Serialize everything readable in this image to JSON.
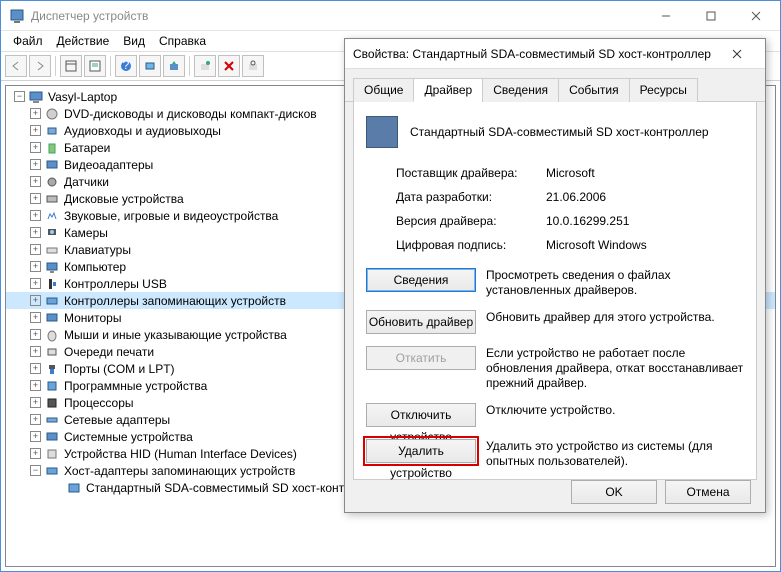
{
  "window": {
    "title": "Диспетчер устройств"
  },
  "menu": {
    "file": "Файл",
    "action": "Действие",
    "view": "Вид",
    "help": "Справка"
  },
  "tree": {
    "root": "Vasyl-Laptop",
    "items": [
      "DVD-дисководы и дисководы компакт-дисков",
      "Аудиовходы и аудиовыходы",
      "Батареи",
      "Видеоадаптеры",
      "Датчики",
      "Дисковые устройства",
      "Звуковые, игровые и видеоустройства",
      "Камеры",
      "Клавиатуры",
      "Компьютер",
      "Контроллеры USB",
      "Контроллеры запоминающих устройств",
      "Мониторы",
      "Мыши и иные указывающие устройства",
      "Очереди печати",
      "Порты (COM и LPT)",
      "Программные устройства",
      "Процессоры",
      "Сетевые адаптеры",
      "Системные устройства",
      "Устройства HID (Human Interface Devices)",
      "Хост-адаптеры запоминающих устройств"
    ],
    "child": "Стандартный SDA-совместимый SD хост-контроллер"
  },
  "dialog": {
    "title": "Свойства: Стандартный SDA-совместимый SD хост-контроллер",
    "tabs": {
      "general": "Общие",
      "driver": "Драйвер",
      "details": "Сведения",
      "events": "События",
      "resources": "Ресурсы"
    },
    "device_name": "Стандартный SDA-совместимый SD хост-контроллер",
    "labels": {
      "vendor": "Поставщик драйвера:",
      "date": "Дата разработки:",
      "version": "Версия драйвера:",
      "sig": "Цифровая подпись:"
    },
    "values": {
      "vendor": "Microsoft",
      "date": "21.06.2006",
      "version": "10.0.16299.251",
      "sig": "Microsoft Windows"
    },
    "buttons": {
      "details": "Сведения",
      "details_desc": "Просмотреть сведения о файлах установленных драйверов.",
      "update": "Обновить драйвер",
      "update_desc": "Обновить драйвер для этого устройства.",
      "rollback": "Откатить",
      "rollback_desc": "Если устройство не работает после обновления драйвера, откат восстанавливает прежний драйвер.",
      "disable": "Отключить устройство",
      "disable_desc": "Отключите устройство.",
      "uninstall": "Удалить устройство",
      "uninstall_desc": "Удалить это устройство из системы (для опытных пользователей)."
    },
    "ok": "OK",
    "cancel": "Отмена"
  }
}
